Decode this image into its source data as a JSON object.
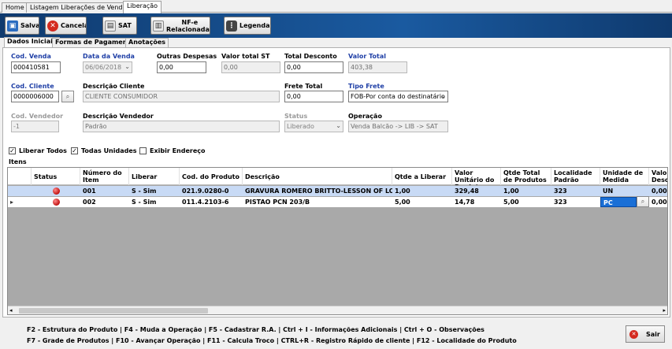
{
  "top_tabs": [
    "Home",
    "Listagem Liberações de Venda",
    "Liberação"
  ],
  "toolbar": {
    "salvar": "Salvar",
    "cancelar": "Cancelar",
    "sat": "SAT",
    "nfe_line1": "NF-e",
    "nfe_line2": "Relacionadas",
    "legendas": "Legendas"
  },
  "sub_tabs": [
    "Dados Iniciais",
    "Formas de Pagamento",
    "Anotações"
  ],
  "form": {
    "cod_venda": {
      "label": "Cod. Venda",
      "value": "000410581"
    },
    "data_venda": {
      "label": "Data da Venda",
      "value": "06/06/2018"
    },
    "outras_despesas": {
      "label": "Outras Despesas",
      "value": "0,00"
    },
    "valor_total_st": {
      "label": "Valor total ST",
      "value": "0,00"
    },
    "total_desconto": {
      "label": "Total Desconto",
      "value": "0,00"
    },
    "valor_total": {
      "label": "Valor Total",
      "value": "403,38"
    },
    "cod_cliente": {
      "label": "Cod. Cliente",
      "value": "0000006000"
    },
    "descricao_cliente": {
      "label": "Descrição Cliente",
      "value": "CLIENTE CONSUMIDOR"
    },
    "frete_total": {
      "label": "Frete Total",
      "value": "0,00"
    },
    "tipo_frete": {
      "label": "Tipo Frete",
      "value": "FOB-Por conta do destinatário"
    },
    "cod_vendedor": {
      "label": "Cod. Vendedor",
      "value": "-1"
    },
    "descricao_vendedor": {
      "label": "Descrição Vendedor",
      "value": "Padrão"
    },
    "status": {
      "label": "Status",
      "value": "Liberado"
    },
    "operacao": {
      "label": "Operação",
      "value": "Venda Balcão -> LIB -> SAT"
    }
  },
  "checkboxes": {
    "liberar_todos": {
      "label": "Liberar Todos",
      "checked": true
    },
    "todas_unidades": {
      "label": "Todas Unidades",
      "checked": true
    },
    "exibir_endereco": {
      "label": "Exibir Endereço",
      "checked": false
    }
  },
  "itens_label": "Itens",
  "grid": {
    "columns": [
      "Status",
      "Número do Item",
      "Liberar",
      "Cod. do Produto",
      "Descrição",
      "Qtde a Liberar",
      "Valor Unitário do Produto",
      "Qtde Total de Produtos",
      "Localidade Padrão",
      "Unidade de Medida",
      "Valor Desc"
    ],
    "rows": [
      {
        "item": "001",
        "liberar": "S - Sim",
        "cod": "021.9.0280-0",
        "desc": "GRAVURA ROMERO BRITTO-LESSON OF LOVE-...",
        "qtde_liberar": "1,00",
        "valor_unit": "329,48",
        "qtde_total": "1,00",
        "localidade": "323",
        "unidade": "UN",
        "valor_desc": "0,00"
      },
      {
        "item": "002",
        "liberar": "S - Sim",
        "cod": "011.4.2103-6",
        "desc": "PISTAO PCN 203/B",
        "qtde_liberar": "5,00",
        "valor_unit": "14,78",
        "qtde_total": "5,00",
        "localidade": "323",
        "unidade": "PC",
        "valor_desc": "0,00"
      }
    ]
  },
  "shortcuts": {
    "line1": "F2 - Estrutura do Produto | F4 - Muda a Operação | F5 - Cadastrar R.A. | Ctrl + I - Informações Adicionais | Ctrl + O - Observações",
    "line2": "F7 - Grade de Produtos | F10 - Avançar Operação | F11 - Calcula Troco | CTRL+R - Registro Rápido de cliente | F12 - Localidade do Produto"
  },
  "sair": "Sair",
  "colors": {
    "toolbar": "#0f3a6e",
    "label_blue": "#1f3fa6",
    "row_selected": "#c8daf5",
    "status_red": "#c01010"
  }
}
